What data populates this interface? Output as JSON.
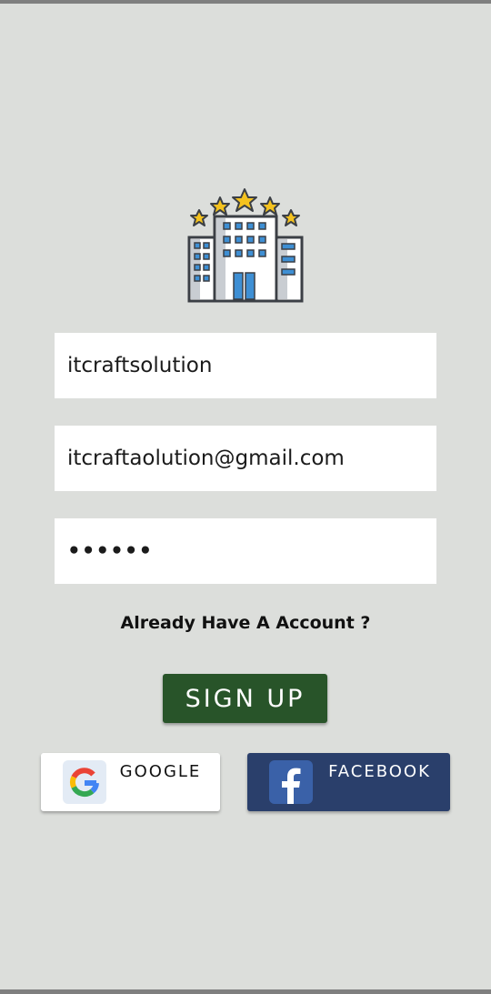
{
  "form": {
    "username_value": "itcraftsolution",
    "email_value": "itcraftaolution@gmail.com",
    "password_value": "••••••"
  },
  "login_link": "Already Have A Account ?",
  "signup_label": "SIGN UP",
  "social": {
    "google_label": "GOOGLE",
    "facebook_label": "FACEBOOK"
  },
  "icons": {
    "logo": "hotel-building-stars-icon",
    "google": "google-icon",
    "facebook": "facebook-icon"
  },
  "colors": {
    "background": "#dcdedb",
    "signup_button": "#285429",
    "facebook_button": "#2a3f6b",
    "star": "#f4c21f",
    "window_blue": "#3e8fd4"
  }
}
